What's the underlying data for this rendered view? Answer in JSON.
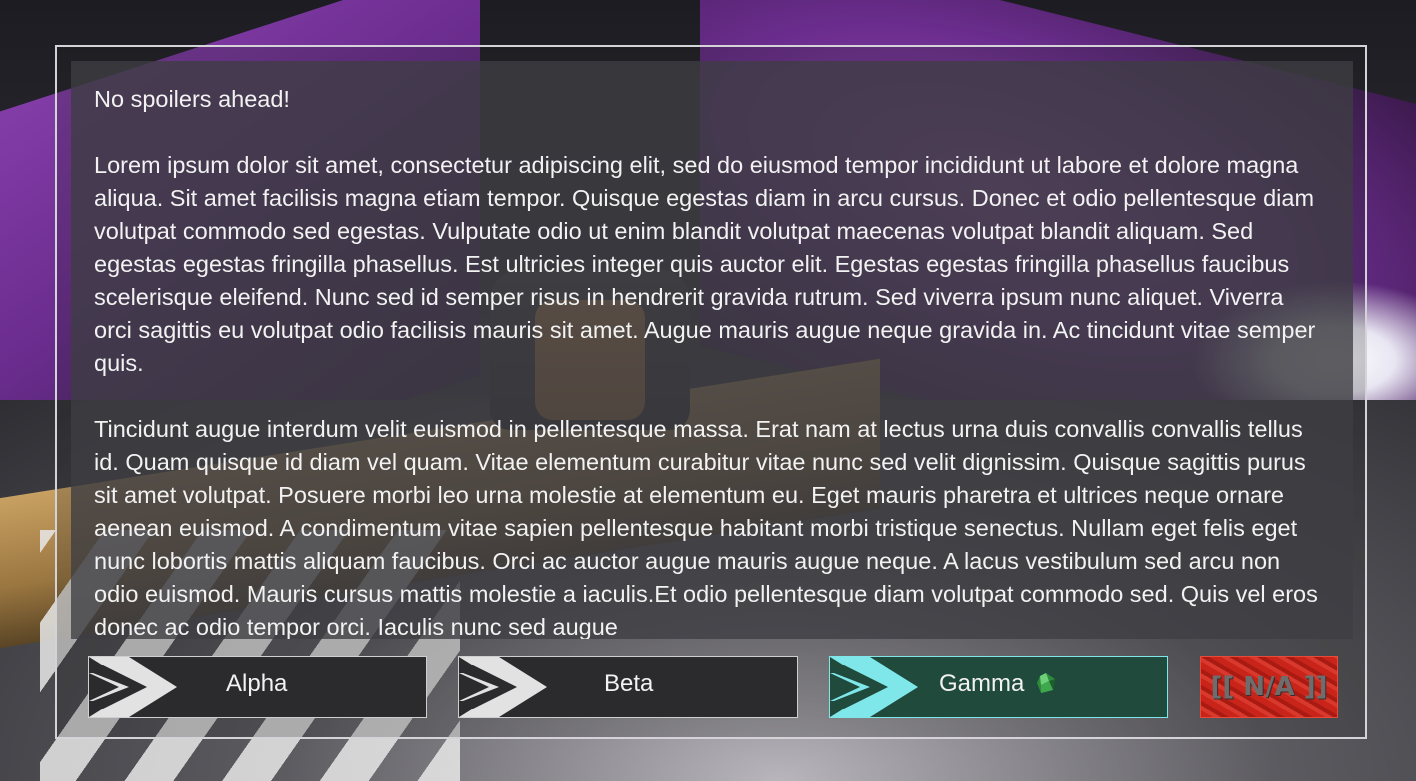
{
  "dialog": {
    "paragraphs": [
      "No spoilers ahead!",
      "Lorem ipsum dolor sit amet, consectetur adipiscing elit, sed do eiusmod tempor incididunt ut labore et dolore magna aliqua. Sit amet facilisis magna etiam tempor. Quisque egestas diam in arcu cursus. Donec et odio pellentesque diam volutpat commodo sed egestas. Vulputate odio ut enim blandit volutpat maecenas volutpat blandit aliquam. Sed egestas egestas fringilla phasellus. Est ultricies integer quis auctor elit. Egestas egestas fringilla phasellus faucibus scelerisque eleifend. Nunc sed id semper risus in hendrerit gravida rutrum. Sed viverra ipsum nunc aliquet. Viverra orci sagittis eu volutpat odio facilisis mauris sit amet. Augue mauris augue neque gravida in. Ac tincidunt vitae semper quis.",
      "Tincidunt augue interdum velit euismod in pellentesque massa. Erat nam at lectus urna duis convallis convallis tellus id. Quam quisque id diam vel quam. Vitae elementum curabitur vitae nunc sed velit dignissim. Quisque sagittis purus sit amet volutpat. Posuere morbi leo urna molestie at elementum eu. Eget mauris pharetra et ultrices neque ornare aenean euismod. A condimentum vitae sapien pellentesque habitant morbi tristique senectus. Nullam eget felis eget nunc lobortis mattis aliquam faucibus. Orci ac auctor augue mauris augue neque. A lacus vestibulum sed arcu non odio euismod. Mauris cursus mattis molestie a iaculis.Et odio pellentesque diam volutpat commodo sed. Quis vel eros donec ac odio tempor orci. Iaculis nunc sed augue"
    ]
  },
  "buttons": {
    "alpha": {
      "label": "Alpha",
      "icon": "double-chevron-right-icon"
    },
    "beta": {
      "label": "Beta",
      "icon": "double-chevron-right-icon"
    },
    "gamma": {
      "label": "Gamma",
      "icon": "double-chevron-right-icon",
      "badge_icon": "green-gem-icon",
      "selected": true,
      "accent": "#7fe7ea"
    },
    "na": {
      "label": "[[ N/A ]]",
      "color": "#c8241a"
    }
  },
  "colors": {
    "panel": "#3e3e42",
    "text": "#f2f2f2",
    "selected_bg": "#1f4a3c"
  }
}
